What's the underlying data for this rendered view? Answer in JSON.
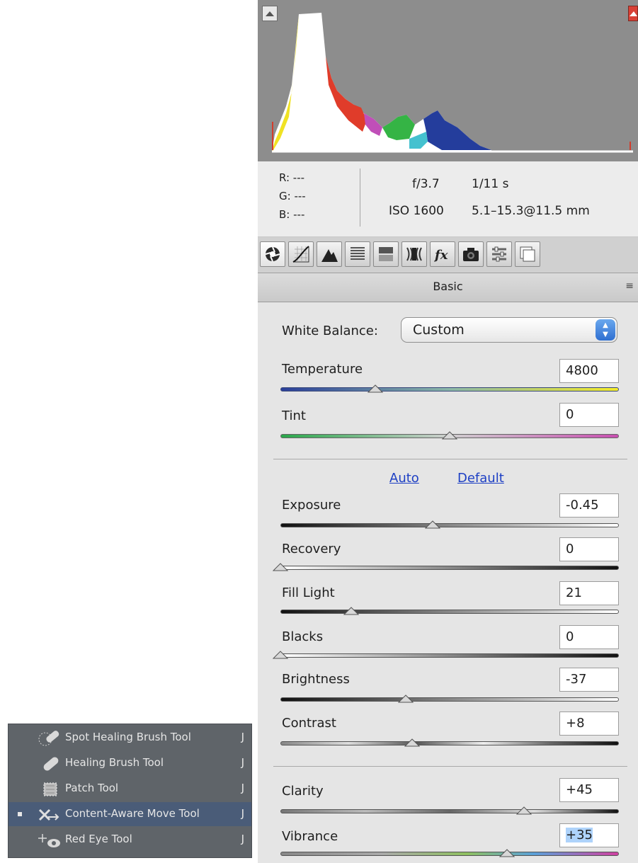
{
  "tool_menu": {
    "items": [
      {
        "label": "Spot Healing Brush Tool",
        "shortcut": "J",
        "icon": "spot-healing-brush-icon",
        "selected": false
      },
      {
        "label": "Healing Brush Tool",
        "shortcut": "J",
        "icon": "healing-brush-icon",
        "selected": false
      },
      {
        "label": "Patch Tool",
        "shortcut": "J",
        "icon": "patch-icon",
        "selected": false
      },
      {
        "label": "Content-Aware Move Tool",
        "shortcut": "J",
        "icon": "content-aware-move-icon",
        "selected": true
      },
      {
        "label": "Red Eye Tool",
        "shortcut": "J",
        "icon": "red-eye-icon",
        "selected": false
      }
    ]
  },
  "camera_info": {
    "r_label": "R:",
    "r_value": "---",
    "g_label": "G:",
    "g_value": "---",
    "b_label": "B:",
    "b_value": "---",
    "aperture": "f/3.7",
    "shutter": "1/11 s",
    "iso": "ISO 1600",
    "lens": "5.1–15.3@11.5 mm"
  },
  "tabs": [
    {
      "name": "tab-basic",
      "icon": "aperture-icon",
      "active": true
    },
    {
      "name": "tab-tone-curve",
      "icon": "tone-curve-icon"
    },
    {
      "name": "tab-detail",
      "icon": "detail-icon"
    },
    {
      "name": "tab-hsl",
      "icon": "hsl-icon"
    },
    {
      "name": "tab-split-toning",
      "icon": "split-toning-icon"
    },
    {
      "name": "tab-lens-corrections",
      "icon": "lens-corrections-icon"
    },
    {
      "name": "tab-effects",
      "icon": "fx-icon"
    },
    {
      "name": "tab-camera-calibration",
      "icon": "camera-icon"
    },
    {
      "name": "tab-presets",
      "icon": "presets-icon"
    },
    {
      "name": "tab-snapshots",
      "icon": "snapshots-icon"
    }
  ],
  "section": {
    "title": "Basic",
    "menu_icon": "panel-menu-icon",
    "menu_glyph": "≡"
  },
  "white_balance": {
    "label": "White Balance:",
    "value": "Custom"
  },
  "links": {
    "auto": "Auto",
    "default": "Default"
  },
  "sliders": {
    "temperature": {
      "label": "Temperature",
      "value": "4800",
      "position": 0.28
    },
    "tint": {
      "label": "Tint",
      "value": "0",
      "position": 0.5
    },
    "exposure": {
      "label": "Exposure",
      "value": "-0.45",
      "position": 0.45
    },
    "recovery": {
      "label": "Recovery",
      "value": "0",
      "position": 0.0
    },
    "fill_light": {
      "label": "Fill Light",
      "value": "21",
      "position": 0.21
    },
    "blacks": {
      "label": "Blacks",
      "value": "0",
      "position": 0.0
    },
    "brightness": {
      "label": "Brightness",
      "value": "-37",
      "position": 0.37
    },
    "contrast": {
      "label": "Contrast",
      "value": "+8",
      "position": 0.39
    },
    "clarity": {
      "label": "Clarity",
      "value": "+45",
      "position": 0.72
    },
    "vibrance": {
      "label": "Vibrance",
      "value": "+35",
      "position": 0.67
    }
  },
  "colors": {
    "selected_row": "#4a5c78",
    "link": "#1d3fc4",
    "clip_highlight": "#d94136"
  }
}
